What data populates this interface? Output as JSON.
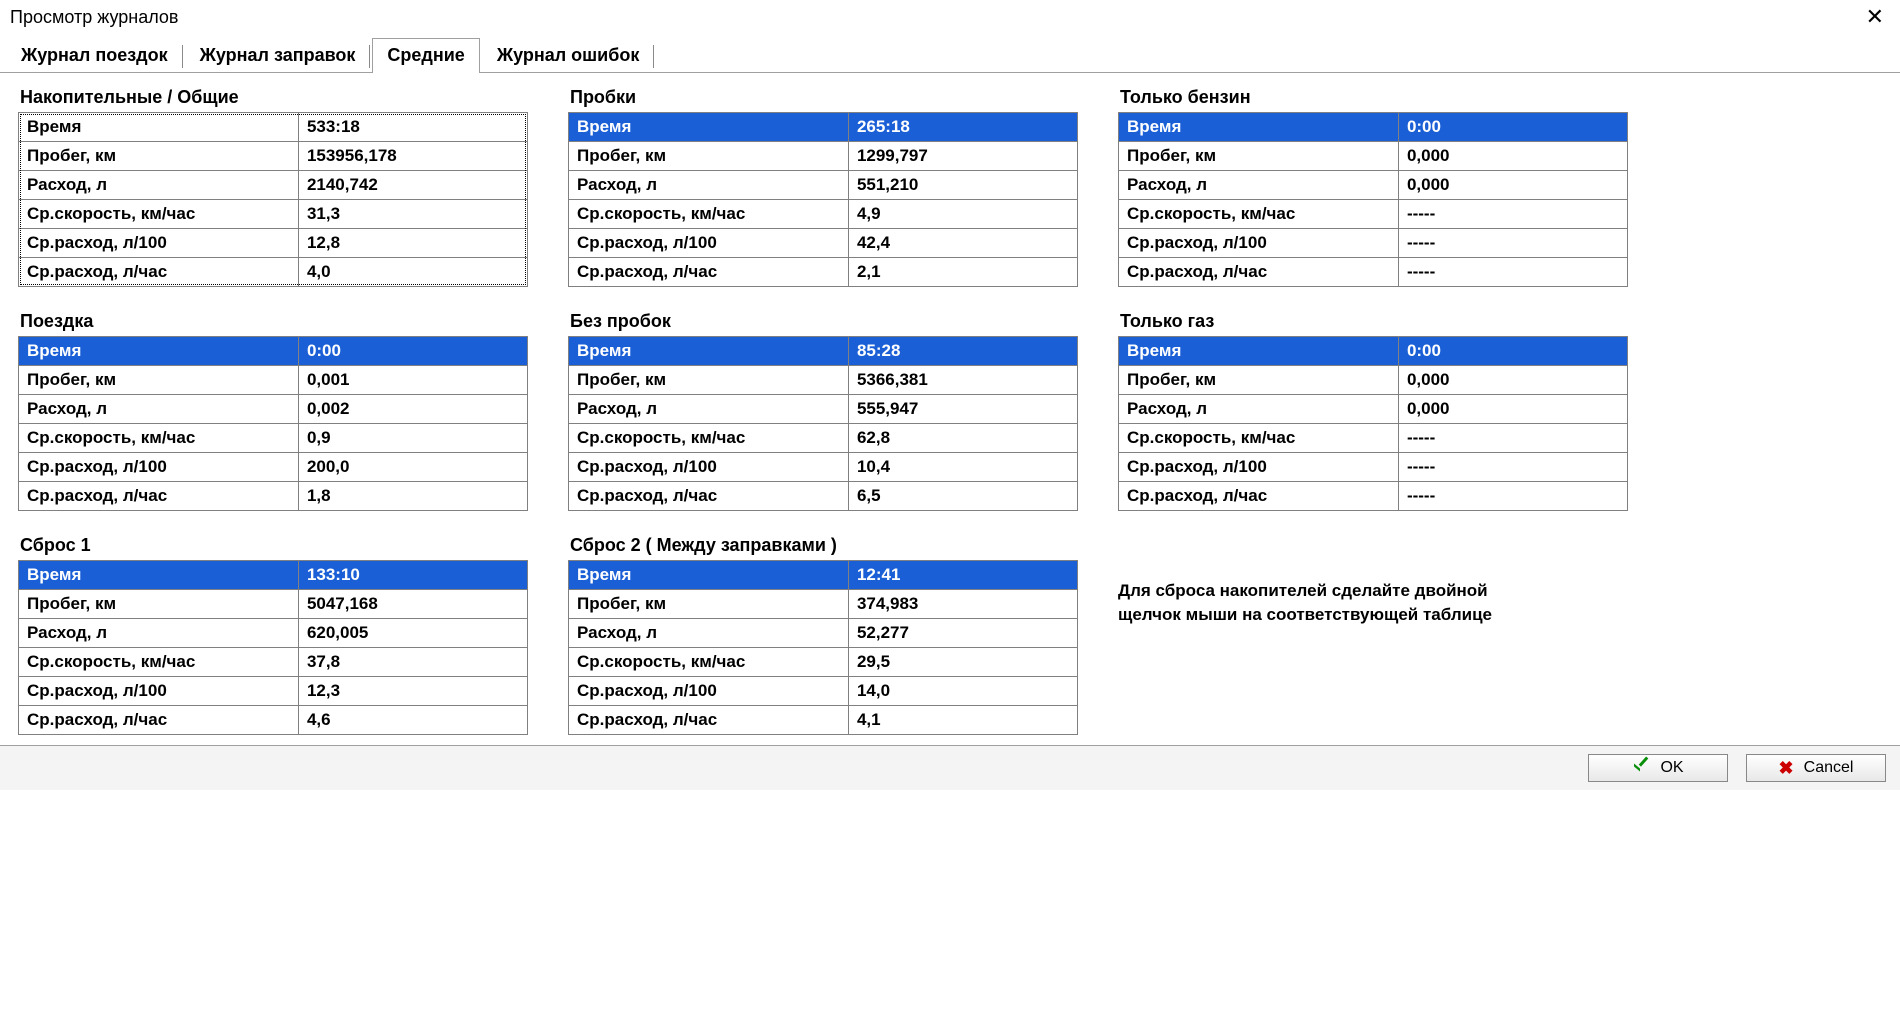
{
  "window": {
    "title": "Просмотр журналов"
  },
  "tabs": {
    "trips": "Журнал поездок",
    "refuels": "Журнал заправок",
    "avg": "Средние",
    "errors": "Журнал ошибок"
  },
  "row_labels": {
    "time": "Время",
    "dist": "Пробег, км",
    "fuel": "Расход, л",
    "speed": "Ср.скорость, км/час",
    "c100": "Ср.расход, л/100",
    "chr": "Ср.расход, л/час"
  },
  "sections": {
    "cumulative": {
      "title": "Накопительные / Общие",
      "highlight": false,
      "v": {
        "time": "533:18",
        "dist": "153956,178",
        "fuel": "2140,742",
        "speed": "31,3",
        "c100": "12,8",
        "chr": "4,0"
      }
    },
    "trip": {
      "title": "Поездка",
      "highlight": true,
      "v": {
        "time": "0:00",
        "dist": "0,001",
        "fuel": "0,002",
        "speed": "0,9",
        "c100": "200,0",
        "chr": "1,8"
      }
    },
    "reset1": {
      "title": "Сброс 1",
      "highlight": true,
      "v": {
        "time": "133:10",
        "dist": "5047,168",
        "fuel": "620,005",
        "speed": "37,8",
        "c100": "12,3",
        "chr": "4,6"
      }
    },
    "jams": {
      "title": "Пробки",
      "highlight": true,
      "v": {
        "time": "265:18",
        "dist": "1299,797",
        "fuel": "551,210",
        "speed": "4,9",
        "c100": "42,4",
        "chr": "2,1"
      }
    },
    "nojams": {
      "title": "Без пробок",
      "highlight": true,
      "v": {
        "time": "85:28",
        "dist": "5366,381",
        "fuel": "555,947",
        "speed": "62,8",
        "c100": "10,4",
        "chr": "6,5"
      }
    },
    "reset2": {
      "title": "Сброс 2 ( Между заправками )",
      "highlight": true,
      "v": {
        "time": "12:41",
        "dist": "374,983",
        "fuel": "52,277",
        "speed": "29,5",
        "c100": "14,0",
        "chr": "4,1"
      }
    },
    "petrol": {
      "title": "Только бензин",
      "highlight": true,
      "v": {
        "time": "0:00",
        "dist": "0,000",
        "fuel": "0,000",
        "speed": "-----",
        "c100": "-----",
        "chr": "-----"
      }
    },
    "gas": {
      "title": "Только газ",
      "highlight": true,
      "v": {
        "time": "0:00",
        "dist": "0,000",
        "fuel": "0,000",
        "speed": "-----",
        "c100": "-----",
        "chr": "-----"
      }
    }
  },
  "hint_line1": "Для сброса накопителей сделайте двойной",
  "hint_line2": "щелчок мыши на соответствующей таблице",
  "buttons": {
    "ok": "OK",
    "cancel": "Cancel"
  }
}
